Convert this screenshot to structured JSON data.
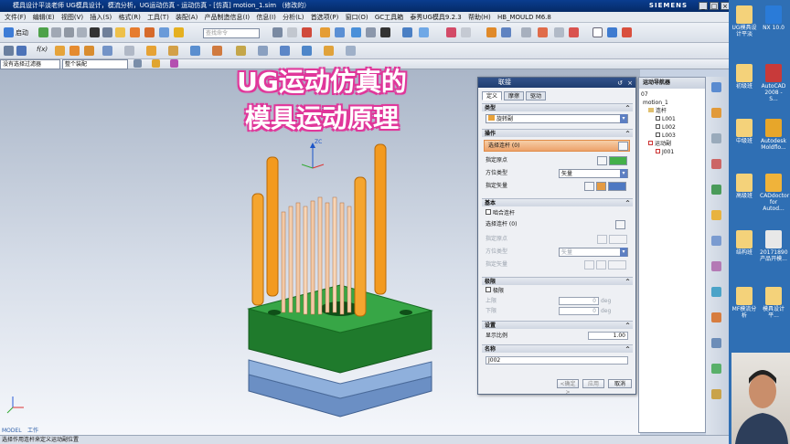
{
  "window": {
    "title": "模具设计平淡老师 UG模具设计，模流分析，UG运动仿真 - 运动仿真 - [仿真] motion_1.sim （修改的）",
    "brand": "SIEMENS"
  },
  "menu": [
    "文件(F)",
    "编辑(E)",
    "视图(V)",
    "插入(S)",
    "格式(R)",
    "工具(T)",
    "装配(A)",
    "产品制造信息(I)",
    "信息(I)",
    "分析(L)",
    "首选项(P)",
    "窗口(O)",
    "GC工具箱",
    "泰秀UG模具9.2.3",
    "帮助(H)",
    "HB_MOULD M6.8"
  ],
  "toolbar": {
    "start_label": "启动",
    "fx_label": "f(x)",
    "search_placeholder": "查找命令"
  },
  "filters": {
    "selection_filter": "没有选择过滤器",
    "scope": "整个装配"
  },
  "overlay_title": [
    "UG运动仿真的",
    "模具运动原理"
  ],
  "axis_label": "ZC",
  "dialog": {
    "title": "联接",
    "tabs": [
      "定义",
      "摩擦",
      "驱动"
    ],
    "type_header": "类型",
    "type_value": "旋转副",
    "action_header": "操作",
    "select_link": "选择连杆 (0)",
    "specify_origin": "指定原点",
    "orientation_type_label": "方位类型",
    "orientation_type_value": "矢量",
    "specify_vector": "指定矢量",
    "base_header": "基本",
    "snap_link": "啮合连杆",
    "base_select_link": "选择连杆 (0)",
    "base_specify_origin": "指定原点",
    "base_orientation_label": "方位类型",
    "base_orientation_value": "矢量",
    "base_specify_vector": "指定矢量",
    "limits_header": "极限",
    "limits_check": "极限",
    "upper_label": "上限",
    "upper_value": "0",
    "lower_label": "下限",
    "lower_value": "0",
    "deg_unit": "deg",
    "settings_header": "设置",
    "display_scale_label": "显示比例",
    "display_scale_value": "1.00",
    "name_header": "名称",
    "name_value": "J002",
    "ok": "<确定>",
    "apply": "应用",
    "cancel": "取消"
  },
  "navigator": {
    "title": "运动导航器",
    "tree": [
      {
        "label": "07",
        "level": 0
      },
      {
        "label": "motion_1",
        "level": 0
      },
      {
        "label": "连杆",
        "level": 1
      },
      {
        "label": "L001",
        "level": 2
      },
      {
        "label": "L002",
        "level": 2
      },
      {
        "label": "L003",
        "level": 2
      },
      {
        "label": "运动副",
        "level": 1
      },
      {
        "label": "J001",
        "level": 2
      }
    ]
  },
  "desktop": [
    {
      "label": "UG模具设计平淡"
    },
    {
      "label": "NX 10.0"
    },
    {
      "label": "初级班"
    },
    {
      "label": "AutoCAD 2008 - S..."
    },
    {
      "label": "中级班"
    },
    {
      "label": "Autodesk Moldflo..."
    },
    {
      "label": "高级班"
    },
    {
      "label": "CADdoctor for Autod..."
    },
    {
      "label": "结构班"
    },
    {
      "label": "20171890 产品开模..."
    },
    {
      "label": "MF模流分析"
    },
    {
      "label": "模具设计平..."
    }
  ],
  "status": {
    "model_label": "MODEL",
    "work_label": "工作",
    "prompt": "选择作用连杆来定义运动副位置"
  },
  "colors": {
    "accent": "#e0389b",
    "highlight": "#f0a060",
    "pillar": "#f39a1f",
    "plate_green": "#2d9a3a",
    "plate_blue": "#7b9fd0"
  }
}
